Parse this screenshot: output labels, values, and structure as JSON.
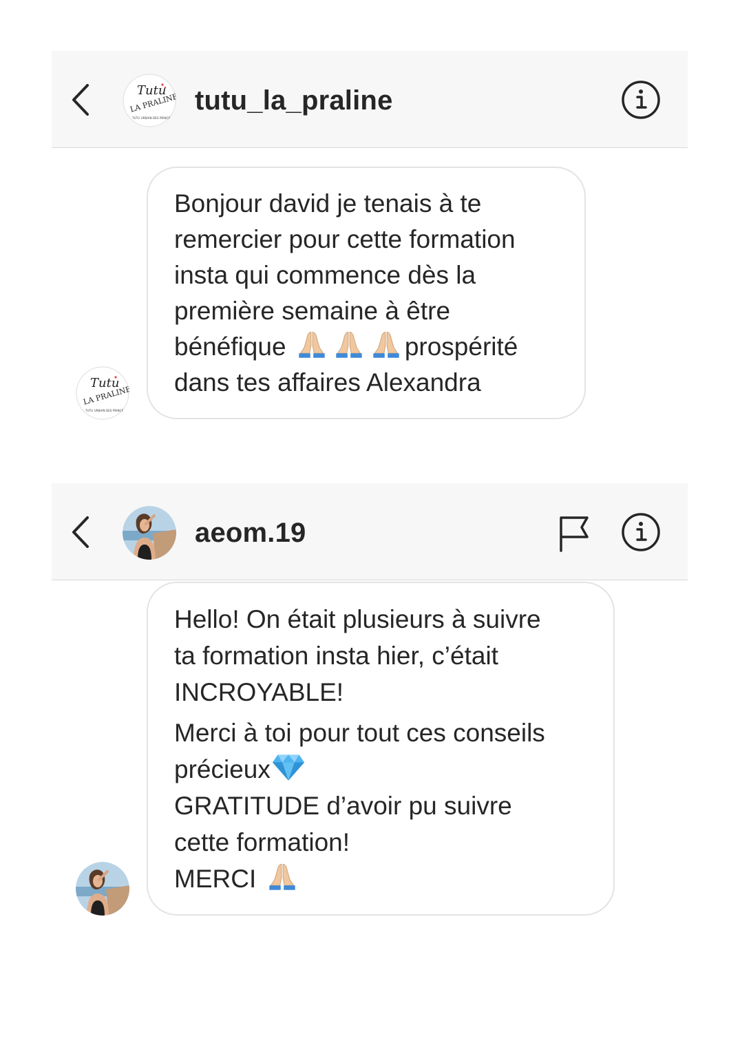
{
  "conversations": [
    {
      "username": "tutu_la_praline",
      "avatar_text": {
        "line1": "Tutu",
        "line2": "LA PRALINE",
        "line3": "TUTU URBAIN DES PRINCES"
      },
      "message": {
        "line1": "Bonjour david je tenais à te",
        "line2": "remercier pour cette formation",
        "line3": "insta qui commence dès la",
        "line4": "première semaine à être",
        "line5_text": "bénéfique",
        "line5_after": "prospérité",
        "line6": "dans tes affaires Alexandra"
      },
      "icons": [
        "back-chevron-icon",
        "info-icon",
        "praying-hands-emoji"
      ]
    },
    {
      "username": "aeom.19",
      "message": {
        "line1": "Hello! On était plusieurs à suivre",
        "line2": "ta formation insta hier, c’était",
        "line3": "INCROYABLE!",
        "line4": "Merci à toi pour tout ces conseils",
        "line5": "précieux",
        "line6": "GRATITUDE d’avoir pu suivre",
        "line7": "cette formation!",
        "line8": "MERCI"
      },
      "icons": [
        "back-chevron-icon",
        "flag-icon",
        "info-icon",
        "gem-emoji",
        "praying-hands-emoji"
      ]
    }
  ],
  "colors": {
    "header_background": "#f7f7f7",
    "bubble_border": "#e3e3e3",
    "text": "#262626"
  }
}
